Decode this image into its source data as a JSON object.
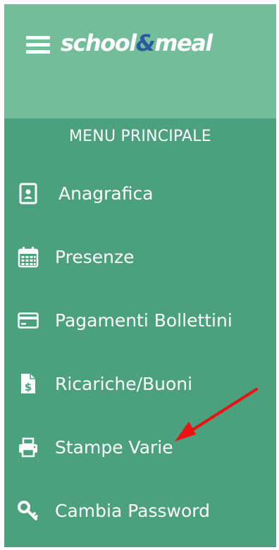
{
  "header": {
    "logo_school": "school",
    "logo_amp": "&",
    "logo_meal": "meal",
    "brand_colors": {
      "header": "#74bd9b",
      "sidebar": "#4ba07e",
      "amp": "#2c5aa0"
    }
  },
  "menu": {
    "title": "MENU PRINCIPALE",
    "items": [
      {
        "label": "Anagrafica",
        "icon": "id-card-icon"
      },
      {
        "label": "Presenze",
        "icon": "calendar-icon"
      },
      {
        "label": "Pagamenti Bollettini",
        "icon": "credit-card-icon"
      },
      {
        "label": "Ricariche/Buoni",
        "icon": "money-document-icon"
      },
      {
        "label": "Stampe Varie",
        "icon": "printer-icon"
      },
      {
        "label": "Cambia Password",
        "icon": "key-icon"
      }
    ]
  },
  "annotation": {
    "arrow_color": "#ee1111"
  }
}
